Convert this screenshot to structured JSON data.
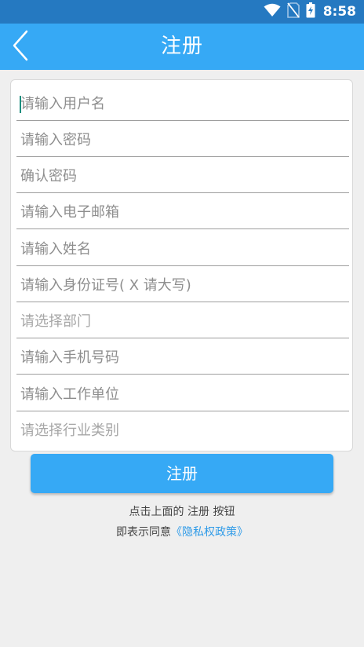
{
  "status_bar": {
    "time": "8:58",
    "icons": [
      "wifi-icon",
      "no-sim-icon",
      "battery-charging-icon"
    ]
  },
  "app_bar": {
    "title": "注册",
    "back_icon": "chevron-left-icon"
  },
  "form": {
    "fields": [
      {
        "placeholder": "请输入用户名",
        "type": "input"
      },
      {
        "placeholder": "请输入密码",
        "type": "input"
      },
      {
        "placeholder": "确认密码",
        "type": "input"
      },
      {
        "placeholder": "请输入电子邮箱",
        "type": "input"
      },
      {
        "placeholder": "请输入姓名",
        "type": "input"
      },
      {
        "placeholder": "请输入身份证号( X 请大写)",
        "type": "input"
      },
      {
        "placeholder": "请选择部门",
        "type": "select"
      },
      {
        "placeholder": "请输入手机号码",
        "type": "input"
      },
      {
        "placeholder": "请输入工作单位",
        "type": "input"
      },
      {
        "placeholder": "请选择行业类别",
        "type": "select"
      }
    ]
  },
  "submit_label": "注册",
  "agreement": {
    "line1": "点击上面的 注册 按钮",
    "line2_prefix": "即表示同意",
    "privacy_link": "《隐私权政策》"
  },
  "colors": {
    "status_bar": "#2579c1",
    "primary": "#36a9f5",
    "link": "#2f9be8",
    "background": "#efefef"
  }
}
